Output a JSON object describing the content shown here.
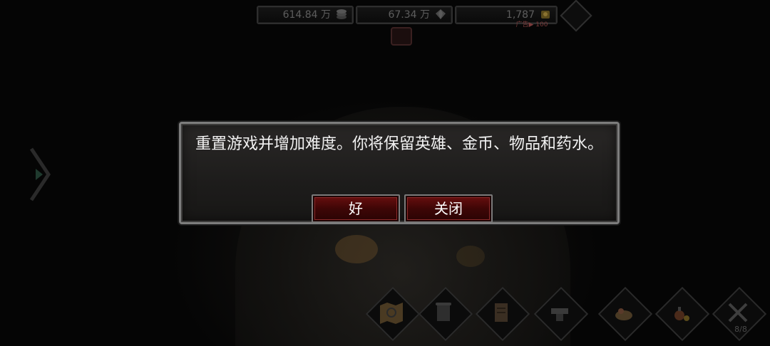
{
  "resources": {
    "gold": {
      "value": "614.84 万",
      "icon": "coin-stack-icon"
    },
    "gems": {
      "value": "67.34 万",
      "icon": "gem-pile-icon"
    },
    "tokens": {
      "value": "1,787",
      "icon": "token-icon"
    }
  },
  "ad_offer": {
    "label": "广告▶ 100"
  },
  "dialog": {
    "message": "重置游戏并增加难度。你将保留英雄、金币、物品和药水。",
    "ok_label": "好",
    "close_label": "关闭"
  },
  "bottom_bar": {
    "counter": "8/8",
    "buttons": [
      "treasure-map-icon",
      "scroll-icon",
      "quest-document-icon",
      "anvil-icon",
      "food-bowl-icon",
      "potion-items-icon",
      "crossed-swords-icon"
    ]
  },
  "colors": {
    "dialog_border": "#7d7d7d",
    "button_red": "#6a0f0f",
    "text": "#f2f2f2"
  }
}
